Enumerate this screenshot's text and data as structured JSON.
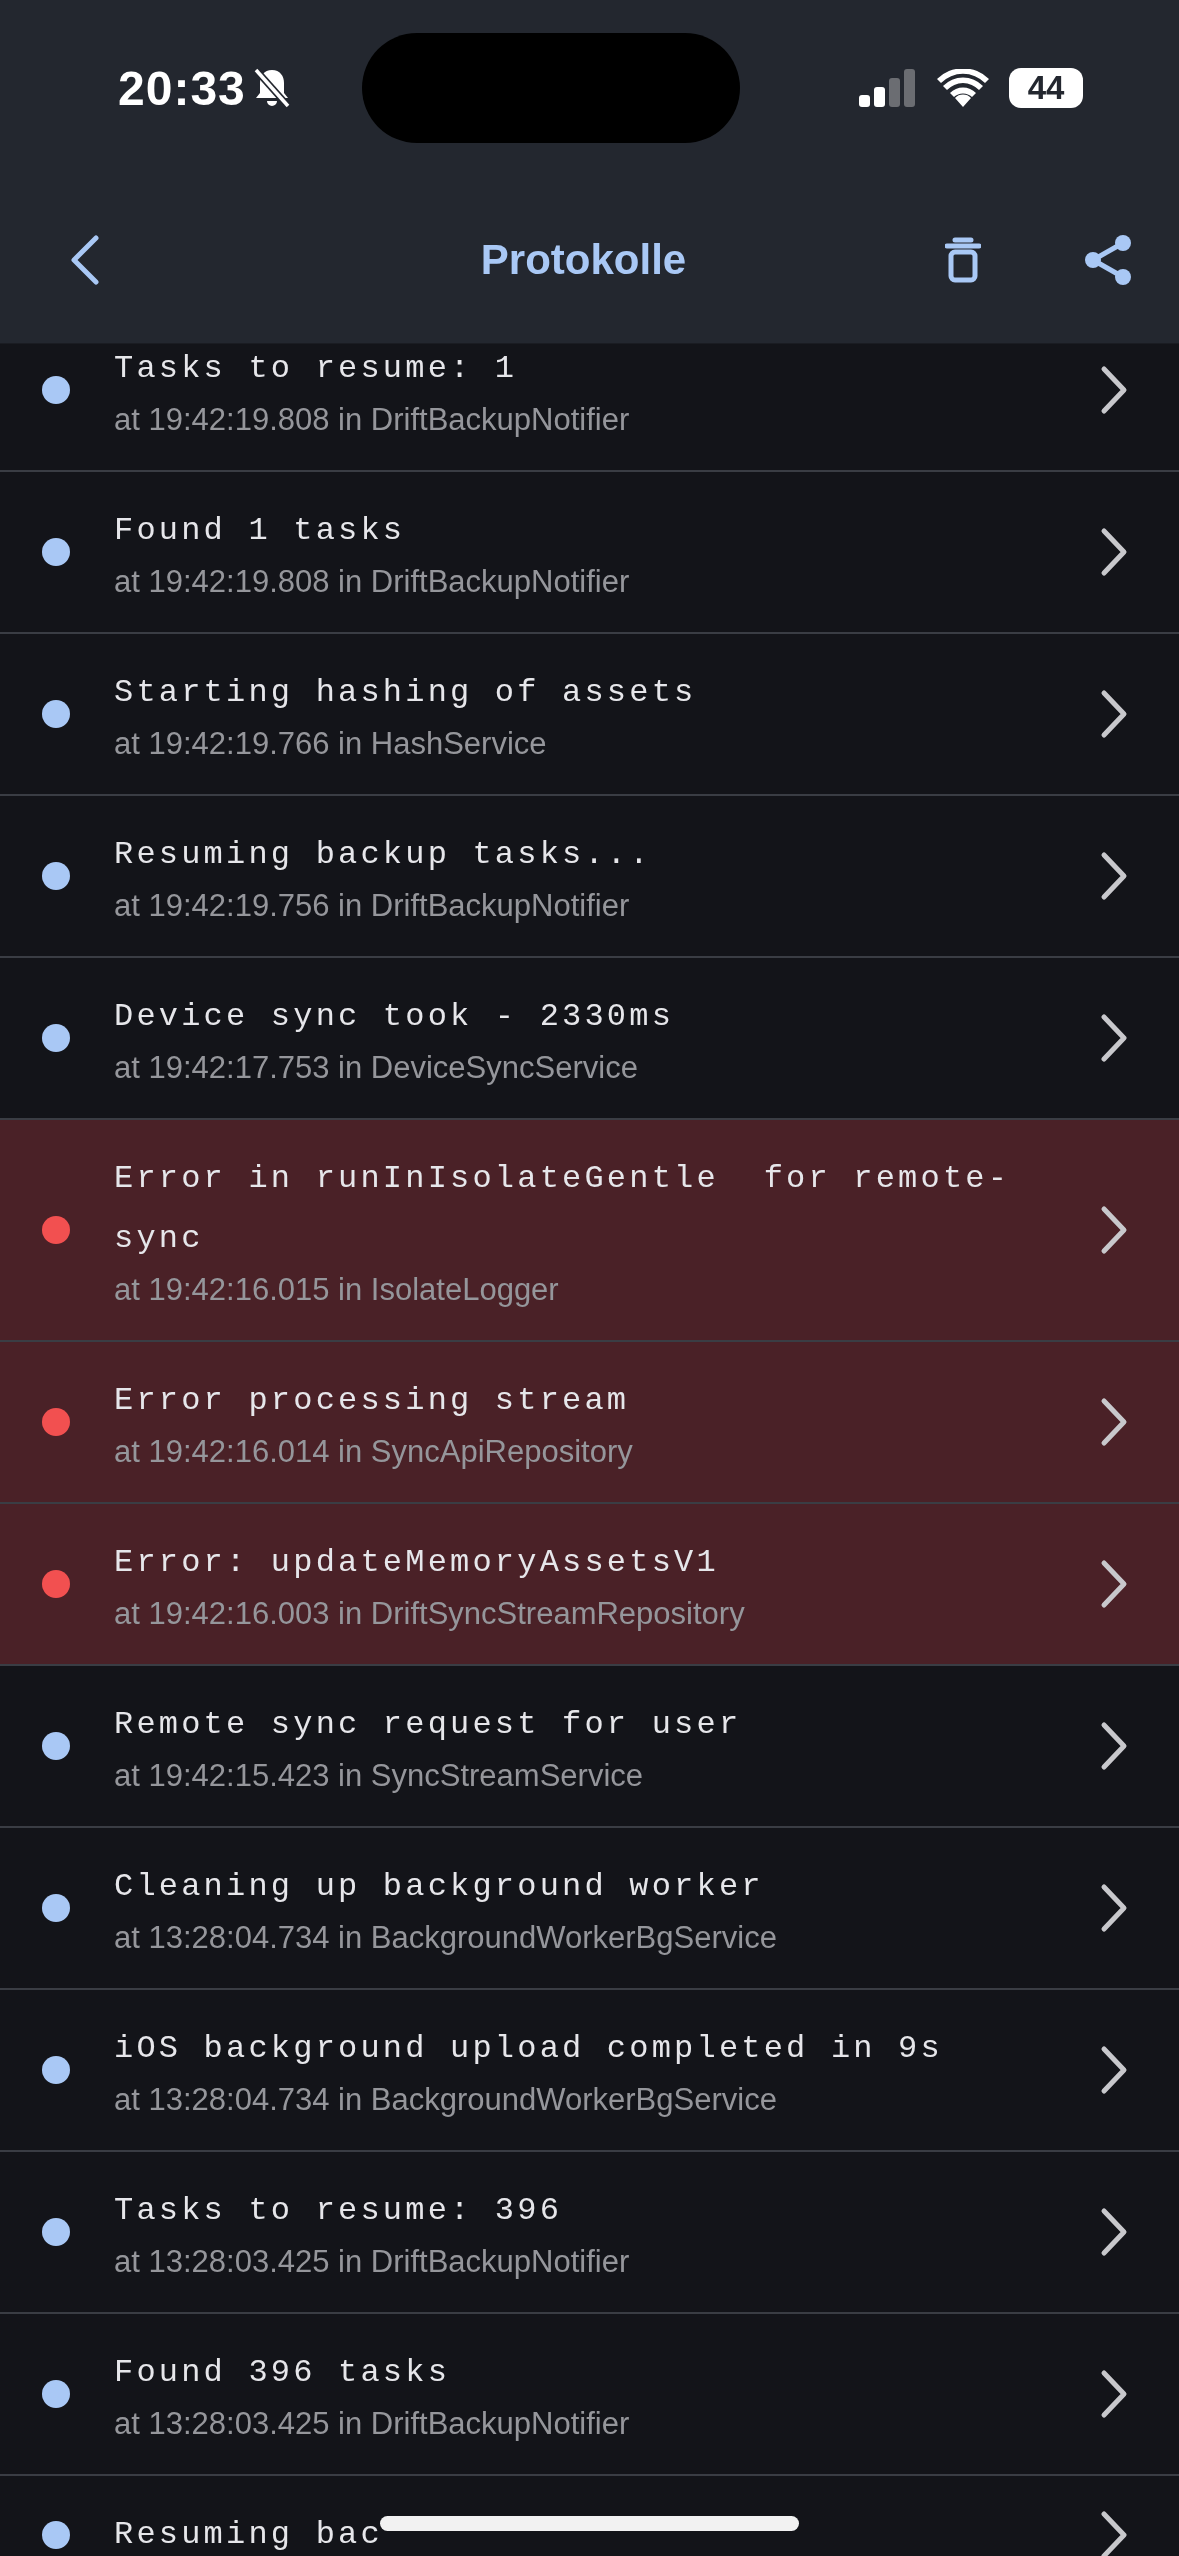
{
  "status_bar": {
    "time": "20:33",
    "battery": "44"
  },
  "header": {
    "title": "Protokolle"
  },
  "logs": [
    {
      "error": false,
      "message": "Tasks to resume: 1",
      "detail": "at 19:42:19.808 in DriftBackupNotifier"
    },
    {
      "error": false,
      "message": "Found 1 tasks",
      "detail": "at 19:42:19.808 in DriftBackupNotifier"
    },
    {
      "error": false,
      "message": "Starting hashing of assets",
      "detail": "at 19:42:19.766 in HashService"
    },
    {
      "error": false,
      "message": "Resuming backup tasks...",
      "detail": "at 19:42:19.756 in DriftBackupNotifier"
    },
    {
      "error": false,
      "message": "Device sync took - 2330ms",
      "detail": "at 19:42:17.753 in DeviceSyncService"
    },
    {
      "error": true,
      "message": "Error in runInIsolateGentle  for remote-sync",
      "detail": "at 19:42:16.015 in IsolateLogger"
    },
    {
      "error": true,
      "message": "Error processing stream",
      "detail": "at 19:42:16.014 in SyncApiRepository"
    },
    {
      "error": true,
      "message": "Error: updateMemoryAssetsV1",
      "detail": "at 19:42:16.003 in DriftSyncStreamRepository"
    },
    {
      "error": false,
      "message": "Remote sync request for user",
      "detail": "at 19:42:15.423 in SyncStreamService"
    },
    {
      "error": false,
      "message": "Cleaning up background worker",
      "detail": "at 13:28:04.734 in BackgroundWorkerBgService"
    },
    {
      "error": false,
      "message": "iOS background upload completed in 9s",
      "detail": "at 13:28:04.734 in BackgroundWorkerBgService"
    },
    {
      "error": false,
      "message": "Tasks to resume: 396",
      "detail": "at 13:28:03.425 in DriftBackupNotifier"
    },
    {
      "error": false,
      "message": "Found 396 tasks",
      "detail": "at 13:28:03.425 in DriftBackupNotifier"
    },
    {
      "error": false,
      "message": "Resuming bac"
    }
  ]
}
